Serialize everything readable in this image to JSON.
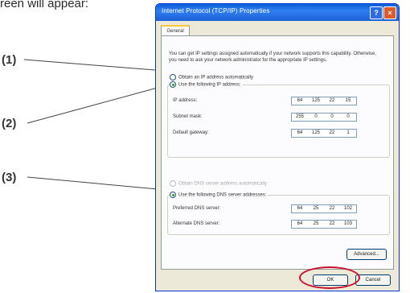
{
  "intro_text": "reen will appear:",
  "callouts": [
    "(1)",
    "(2)",
    "(3)"
  ],
  "dialog": {
    "title": "Internet Protocol (TCP/IP) Properties",
    "help_glyph": "?",
    "close_glyph": "×",
    "tab_general": "General",
    "description": "You can get IP settings assigned automatically if your network supports this capability. Otherwise, you need to ask your network administrator for the appropriate IP settings.",
    "opt_auto_ip": "Obtain an IP address automatically",
    "opt_use_ip": "Use the following IP address:",
    "label_ip": "IP address:",
    "label_subnet": "Subnet mask:",
    "label_gateway": "Default gateway:",
    "ip_address": [
      "64",
      "125",
      "22",
      "15"
    ],
    "subnet_mask": [
      "255",
      "0",
      "0",
      "0"
    ],
    "default_gateway": [
      "64",
      "125",
      "22",
      "1"
    ],
    "opt_auto_dns": "Obtain DNS server address automatically",
    "opt_use_dns": "Use the following DNS server addresses:",
    "label_preferred_dns": "Preferred DNS server:",
    "label_alternate_dns": "Alternate DNS server:",
    "preferred_dns": [
      "64",
      "25",
      "22",
      "102"
    ],
    "alternate_dns": [
      "64",
      "25",
      "22",
      "103"
    ],
    "advanced_label": "Advanced...",
    "ok_label": "OK",
    "cancel_label": "Cancel"
  },
  "colors": {
    "highlight_ring": "#c8102e",
    "title_bar": "#1d5fd6",
    "dialog_bg": "#ece9d8"
  },
  "icons": {
    "help": "help-icon",
    "close": "close-icon",
    "radio": "radio-icon"
  }
}
